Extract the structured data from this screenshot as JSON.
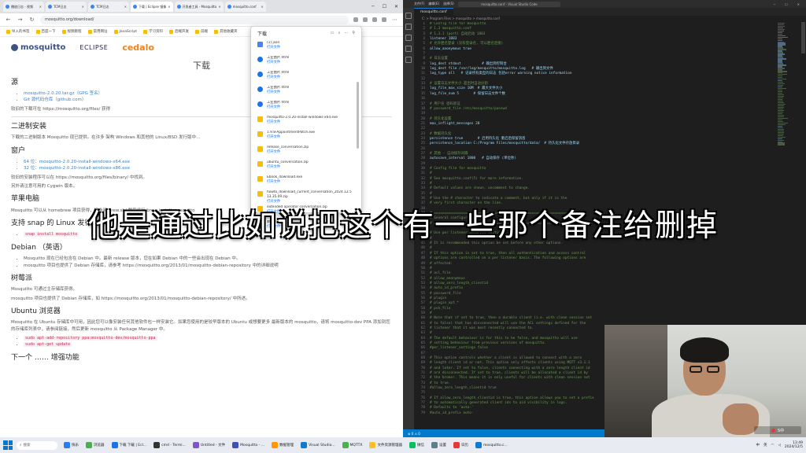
{
  "browser": {
    "tabs": [
      {
        "label": "播放日志 - 视频"
      },
      {
        "label": "TCM日志"
      },
      {
        "label": "TCM日志"
      },
      {
        "label": "下载 | Eclipse 镜像"
      },
      {
        "label": "开发者工具 - Mosquitto"
      },
      {
        "label": "mosquitto.conf"
      }
    ],
    "window_controls": {
      "min": "─",
      "max": "☐",
      "close": "✕"
    },
    "url": "mosquitto.org/download/",
    "bookmarks": [
      "导入的书签",
      "百度一下",
      "视频教程",
      "常用网址",
      "JavaScript",
      "学习资料",
      "后端开发",
      "前端",
      "其他收藏夹"
    ],
    "logos": {
      "mosquitto": "mosquitto",
      "eclipse": "ECLIPSE",
      "cedalo": "cedalo"
    },
    "page": {
      "title": "下载",
      "source_heading": "源",
      "source_items": [
        "mosquitto-2.0.20.tar.gz（GPG 签名）",
        "Git 源代码仓库（github.com）"
      ],
      "source_note": "较旧的下载可在 https://mosquitto.org/files/ 获得",
      "binary_heading": "二进制安装",
      "binary_text": "下载的二进制版本 Mosquitto 现已提供。在许多 架构 Windows 和其他的 Linux/BSD 发行版中...",
      "windows_heading": "窗户",
      "windows_items": [
        "64 位：mosquitto-2.0.20-install-windows-x64.exe",
        "32 位：mosquitto-2.0.20-install-windows-x86.exe"
      ],
      "windows_note": "较旧的安装程序可以在 https://mosquitto.org/files/binary/ 中找到。",
      "windows_note2": "另外请注意可用的 Cygwin 版本。",
      "mac_heading": "苹果电脑",
      "mac_text": "Mosquitto 可以从 homebrew 项目获得，请参阅 brew.sh/ 然后运行 brew install mosquitto",
      "snap_heading": "支持 snap 的 Linux 发行版",
      "snap_code": "snap install mosquitto",
      "debian_heading": "Debian （英语）",
      "debian_items": [
        "Mosquitto 现在已经包含在 Debian 中。最新 release 版本，您在如果 Debian 中的一些会出现在 Debian 中。",
        "mosquitto 项目也提供了 Debian 存储库，请参考 https://mosquitto.org/2013/01/mosquitto-debian-repository 中的详细说明"
      ],
      "raspbian_heading": "树莓派",
      "raspbian_text": "Mosquitto 可通过主存储库获得。",
      "raspbian_text2": "mosquitto 项目也提供了 Debian 存储库，如 https://mosquitto.org/2013/01/mosquitto-debian-repository/ 中所述。",
      "ubuntu_heading": "Ubuntu 浏览器",
      "ubuntu_text": "Mosquitto 在 Ubuntu 存储库中可用，因此您可以像安装任何其他软件包一样安装它。如果您使用的是较早版本的 Ubuntu 或想要更多 最新版本的 mosquitto，请将 mosquitto-dev PPA 添加到您的存储库列表中，请参阅链接，然后更新 mosquitto 从 Package Manager 中。",
      "ubuntu_code1": "sudo apt-add-repository ppa:mosquitto-dev/mosquitto-ppa",
      "ubuntu_code2": "sudo apt-get update",
      "next_heading": "下一个 …… 增强功能"
    }
  },
  "downloads": {
    "title": "下载",
    "items": [
      {
        "name": "(1).json",
        "sub": "打开文件"
      },
      {
        "name": "工业图片.html",
        "sub": "打开文件"
      },
      {
        "name": "工业图片.html",
        "sub": "打开文件"
      },
      {
        "name": "工业图片.html",
        "sub": "打开文件"
      },
      {
        "name": "工业图片.html",
        "sub": "打开文件"
      },
      {
        "name": "mosquitto-2.0.20-install-windows-x64.exe",
        "sub": "打开文件"
      },
      {
        "name": "1.9.8-AppointmentPatch.exe",
        "sub": "打开文件"
      },
      {
        "name": "release_conversation.zip",
        "sub": "打开文件"
      },
      {
        "name": "ubuntu_conversation.zip",
        "sub": "打开文件"
      },
      {
        "name": "Ebook_download.exe",
        "sub": "打开文件"
      },
      {
        "name": "howto_download_current_conversation_2024.12.5 13.35.09.zip",
        "sub": "打开文件"
      },
      {
        "name": "extended operator conversation.zip",
        "sub": "打开文件"
      },
      {
        "name": "翻译机器人.html",
        "sub": "打开文件"
      }
    ]
  },
  "editor": {
    "menu": [
      "文件(F)",
      "编辑(E)",
      "选择(S)",
      "查看(V)",
      "转到(G)",
      "运行(R)",
      "终端(T)",
      "帮助(H)"
    ],
    "search": "mosquitto.conf - Visual Studio Code",
    "tab": "mosquitto.conf",
    "breadcrumb": "C: > Program Files > mosquitto > mosquitto.conf",
    "lines": [
      {
        "n": "1",
        "t": "# Config file for mosquitto",
        "c": "comment"
      },
      {
        "n": "2",
        "t": "# 1.3 mosquitto.conf",
        "c": "comment"
      },
      {
        "n": "3",
        "t": "# 1.3.1 (port) 自动启动 1883",
        "c": "comment"
      },
      {
        "n": "4",
        "t": "listener 1883",
        "c": "key"
      },
      {
        "n": "5",
        "t": "# 允许匿名登录 (没有登录名, 可以匿名连接)",
        "c": "comment"
      },
      {
        "n": "6",
        "t": "allow_anonymous true",
        "c": "key"
      },
      {
        "n": "7",
        "t": "",
        "c": "key"
      },
      {
        "n": "8",
        "t": "# 日志设置",
        "c": "comment"
      },
      {
        "n": "9",
        "t": "log_dest stdout          # 输出到控制台",
        "c": "key"
      },
      {
        "n": "10",
        "t": "log_dest file /var/log/mosquitto/mosquitto.log   # 输出到文件",
        "c": "key"
      },
      {
        "n": "11",
        "t": "log_type all   # 记录所有类型的日志 包括error warning notice information",
        "c": "key"
      },
      {
        "n": "12",
        "t": "",
        "c": "key"
      },
      {
        "n": "13",
        "t": "# 设置日志文件大小 超出时自动分割",
        "c": "comment"
      },
      {
        "n": "14",
        "t": "log_file_max_size 10M  # 最大文件大小",
        "c": "key"
      },
      {
        "n": "15",
        "t": "log_file_num 5       # 保留日志文件个数",
        "c": "key"
      },
      {
        "n": "16",
        "t": "",
        "c": "key"
      },
      {
        "n": "17",
        "t": "# 用户名 密码验证",
        "c": "comment"
      },
      {
        "n": "18",
        "t": "# password_file /etc/mosquitto/passwd",
        "c": "comment"
      },
      {
        "n": "19",
        "t": "",
        "c": "key"
      },
      {
        "n": "20",
        "t": "# 持久化设置",
        "c": "comment"
      },
      {
        "n": "21",
        "t": "max_inflight_messages 20",
        "c": "key"
      },
      {
        "n": "22",
        "t": "",
        "c": "key"
      },
      {
        "n": "23",
        "t": "# 数据持久化",
        "c": "comment"
      },
      {
        "n": "24",
        "t": "persistence true       # 启用持久化 重启后保留消息",
        "c": "key"
      },
      {
        "n": "25",
        "t": "persistence_location C:/Program Files/mosquitto/data/  # 持久化文件存放目录",
        "c": "key"
      },
      {
        "n": "26",
        "t": "",
        "c": "key"
      },
      {
        "n": "27",
        "t": "# 其他 - 自动保存间隔",
        "c": "comment"
      },
      {
        "n": "28",
        "t": "autosave_interval 1800   # 自动保存 (单位秒)",
        "c": "key"
      },
      {
        "n": "29",
        "t": "",
        "c": "key"
      },
      {
        "n": "30",
        "t": "# Config file for mosquitto",
        "c": "comment"
      },
      {
        "n": "31",
        "t": "#",
        "c": "comment"
      },
      {
        "n": "32",
        "t": "# See mosquitto.conf(5) for more information.",
        "c": "comment"
      },
      {
        "n": "33",
        "t": "#",
        "c": "comment"
      },
      {
        "n": "34",
        "t": "# Default values are shown, uncomment to change.",
        "c": "comment"
      },
      {
        "n": "35",
        "t": "#",
        "c": "comment"
      },
      {
        "n": "36",
        "t": "# Use the # character to indicate a comment, but only if it is the",
        "c": "comment"
      },
      {
        "n": "37",
        "t": "# very first character on the line.",
        "c": "comment"
      },
      {
        "n": "38",
        "t": "",
        "c": "key"
      },
      {
        "n": "39",
        "t": "# =================================================================",
        "c": "comment"
      },
      {
        "n": "40",
        "t": "# General configuration",
        "c": "comment"
      },
      {
        "n": "41",
        "t": "# =================================================================",
        "c": "comment"
      },
      {
        "n": "42",
        "t": "",
        "c": "key"
      },
      {
        "n": "43",
        "t": "# Use per listener security settings.",
        "c": "comment"
      },
      {
        "n": "44",
        "t": "#",
        "c": "comment"
      },
      {
        "n": "45",
        "t": "# It is recommended this option be set before any other options.",
        "c": "comment"
      },
      {
        "n": "46",
        "t": "#",
        "c": "comment"
      },
      {
        "n": "47",
        "t": "# If this option is set to true, then all authentication and access control",
        "c": "comment"
      },
      {
        "n": "48",
        "t": "# options are controlled on a per listener basis. The following options are",
        "c": "comment"
      },
      {
        "n": "49",
        "t": "# affected:",
        "c": "comment"
      },
      {
        "n": "50",
        "t": "#",
        "c": "comment"
      },
      {
        "n": "51",
        "t": "# acl_file",
        "c": "comment"
      },
      {
        "n": "52",
        "t": "# allow_anonymous",
        "c": "comment"
      },
      {
        "n": "53",
        "t": "# allow_zero_length_clientid",
        "c": "comment"
      },
      {
        "n": "54",
        "t": "# auto_id_prefix",
        "c": "comment"
      },
      {
        "n": "55",
        "t": "# password_file",
        "c": "comment"
      },
      {
        "n": "56",
        "t": "# plugin",
        "c": "comment"
      },
      {
        "n": "57",
        "t": "# plugin_opt_*",
        "c": "comment"
      },
      {
        "n": "58",
        "t": "# psk_file",
        "c": "comment"
      },
      {
        "n": "59",
        "t": "#",
        "c": "comment"
      },
      {
        "n": "60",
        "t": "# Note that if set to true, then a durable client (i.e. with clean session set",
        "c": "comment"
      },
      {
        "n": "61",
        "t": "# to false) that has disconnected will use the ACL settings defined for the",
        "c": "comment"
      },
      {
        "n": "62",
        "t": "# listener that it was most recently connected to.",
        "c": "comment"
      },
      {
        "n": "63",
        "t": "#",
        "c": "comment"
      },
      {
        "n": "64",
        "t": "# The default behaviour is for this to be false, and mosquitto will use",
        "c": "comment"
      },
      {
        "n": "65",
        "t": "# setting behaviour from previous versions of mosquitto.",
        "c": "comment"
      },
      {
        "n": "66",
        "t": "#per_listener_settings false",
        "c": "comment"
      },
      {
        "n": "67",
        "t": "",
        "c": "key"
      },
      {
        "n": "68",
        "t": "# This option controls whether a client is allowed to connect with a zero",
        "c": "comment"
      },
      {
        "n": "69",
        "t": "# length client id or not. This option only affects clients using MQTT v3.1.1",
        "c": "comment"
      },
      {
        "n": "70",
        "t": "# and later. If set to false, clients connecting with a zero length client id",
        "c": "comment"
      },
      {
        "n": "71",
        "t": "# are disconnected. If set to true, clients will be allocated a client id by",
        "c": "comment"
      },
      {
        "n": "72",
        "t": "# the broker. This means it is only useful for clients with clean session set",
        "c": "comment"
      },
      {
        "n": "73",
        "t": "# to true.",
        "c": "comment"
      },
      {
        "n": "74",
        "t": "#allow_zero_length_clientid true",
        "c": "comment"
      },
      {
        "n": "75",
        "t": "",
        "c": "key"
      },
      {
        "n": "76",
        "t": "# If allow_zero_length_clientid is true, this option allows you to set a prefix",
        "c": "comment"
      },
      {
        "n": "77",
        "t": "# to automatically generated client ids to aid visibility in logs.",
        "c": "comment"
      },
      {
        "n": "78",
        "t": "# Defaults to 'auto-'",
        "c": "comment"
      },
      {
        "n": "79",
        "t": "#auto_id_prefix auto-",
        "c": "comment"
      }
    ],
    "status_left": "⊗ 0  ⚠ 0",
    "status_right": [
      "行 25, 列 1",
      "空格: 4",
      "UTF-8",
      "CRLF",
      "Properties"
    ]
  },
  "webcam": {
    "watermark": "S中"
  },
  "subtitle": "他是通过比如说把这个有一些那个备注给删掉",
  "taskbar": {
    "search": "搜索",
    "items": [
      {
        "label": "快乐",
        "color": "#2b7de9"
      },
      {
        "label": "浏览器",
        "color": "#4caf50"
      },
      {
        "label": "下载 下载 | Ecl...",
        "color": "#1a73e8"
      },
      {
        "label": "cmd - Termi...",
        "color": "#333333"
      },
      {
        "label": "Untitled - 文件",
        "color": "#7e57c2"
      },
      {
        "label": "Mosquitto - ...",
        "color": "#3f51b5"
      },
      {
        "label": "数据管理",
        "color": "#ff9800"
      },
      {
        "label": "Visual Studio...",
        "color": "#0e7ad3"
      },
      {
        "label": "MQTTX",
        "color": "#4caf50"
      },
      {
        "label": "文件资源管理器",
        "color": "#fbc02d"
      },
      {
        "label": "微信",
        "color": "#07c160"
      },
      {
        "label": "设置",
        "color": "#607d8b"
      },
      {
        "label": "日历",
        "color": "#e53935"
      },
      {
        "label": "mosquitto.c...",
        "color": "#0e7ad3"
      }
    ],
    "tray": [
      "中",
      "英"
    ],
    "time": "13:49",
    "date": "2024/12/5"
  }
}
